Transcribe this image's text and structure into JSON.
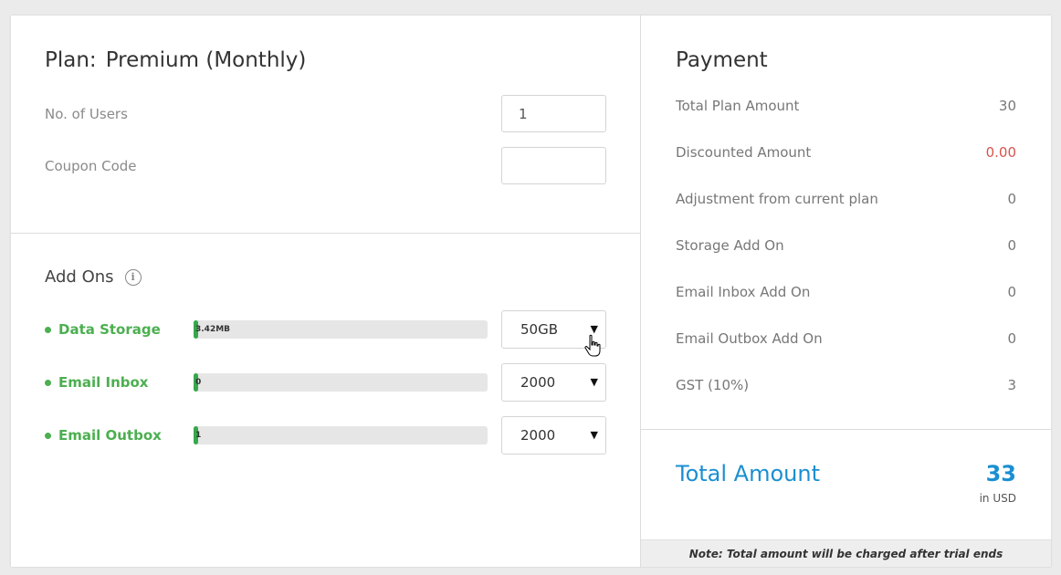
{
  "plan": {
    "label": "Plan:",
    "name": "Premium (Monthly)",
    "users_label": "No. of Users",
    "users_value": "1",
    "coupon_label": "Coupon Code",
    "coupon_value": ""
  },
  "addons": {
    "title": "Add Ons",
    "info_icon": "info-icon",
    "items": [
      {
        "name": "Data Storage",
        "usage_text": "3.42MB",
        "usage_fraction": 0.015,
        "selected": "50GB"
      },
      {
        "name": "Email Inbox",
        "usage_text": "0",
        "usage_fraction": 0.015,
        "selected": "2000"
      },
      {
        "name": "Email Outbox",
        "usage_text": "1",
        "usage_fraction": 0.015,
        "selected": "2000"
      }
    ]
  },
  "payment": {
    "title": "Payment",
    "rows": [
      {
        "label": "Total Plan Amount",
        "value": "30"
      },
      {
        "label": "Discounted Amount",
        "value": "0.00"
      },
      {
        "label": "Adjustment from current plan",
        "value": "0"
      },
      {
        "label": "Storage Add On",
        "value": "0"
      },
      {
        "label": "Email Inbox Add On",
        "value": "0"
      },
      {
        "label": "Email Outbox Add On",
        "value": "0"
      },
      {
        "label": "GST (10%)",
        "value": "3"
      }
    ],
    "total_label": "Total Amount",
    "total_value": "33",
    "total_unit": "in USD",
    "note": "Note: Total amount will be charged after trial ends"
  },
  "colors": {
    "accent": "#1a8fd1",
    "addon_green": "#4caf50",
    "bar_fill": "#35a84a",
    "discount_red": "#d9534f"
  }
}
